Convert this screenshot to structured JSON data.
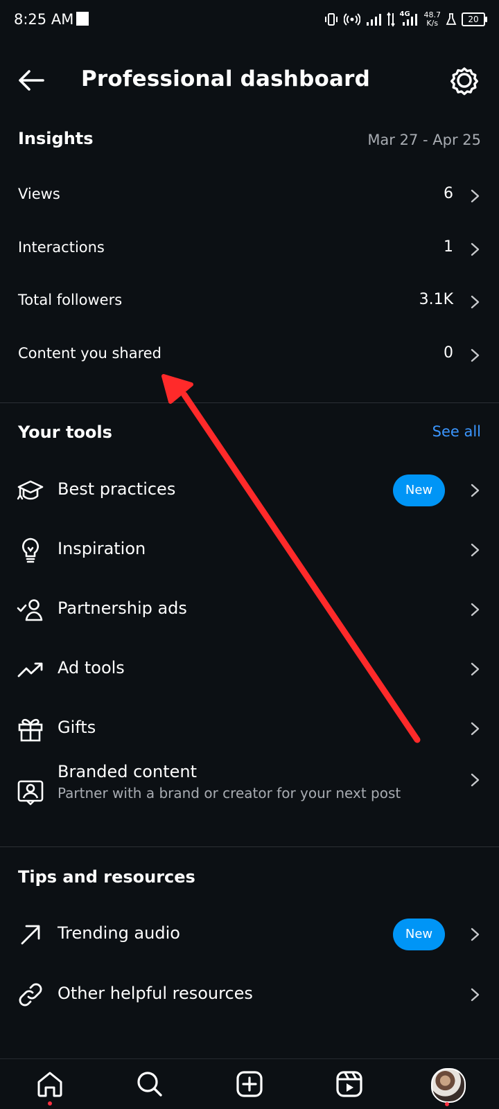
{
  "status_bar": {
    "time": "8:25 AM",
    "speed_value": "48.7",
    "speed_unit": "K/s",
    "network": "4G",
    "battery": "20"
  },
  "header": {
    "title": "Professional dashboard",
    "back_icon": "arrow-left-icon",
    "settings_icon": "gear-icon"
  },
  "insights": {
    "heading": "Insights",
    "date_range": "Mar 27 - Apr 25",
    "rows": [
      {
        "label": "Views",
        "value": "6"
      },
      {
        "label": "Interactions",
        "value": "1"
      },
      {
        "label": "Total followers",
        "value": "3.1K"
      },
      {
        "label": "Content you shared",
        "value": "0"
      }
    ]
  },
  "tools": {
    "heading": "Your tools",
    "see_all": "See all",
    "items": [
      {
        "label": "Best practices",
        "icon": "graduation-cap-icon",
        "badge": "New"
      },
      {
        "label": "Inspiration",
        "icon": "lightbulb-icon"
      },
      {
        "label": "Partnership ads",
        "icon": "person-check-icon"
      },
      {
        "label": "Ad tools",
        "icon": "trending-line-icon"
      },
      {
        "label": "Gifts",
        "icon": "gift-icon"
      },
      {
        "label": "Branded content",
        "sublabel": "Partner with a brand or creator for your next post",
        "icon": "branded-content-icon"
      }
    ]
  },
  "tips": {
    "heading": "Tips and resources",
    "items": [
      {
        "label": "Trending audio",
        "icon": "arrow-up-right-icon",
        "badge": "New"
      },
      {
        "label": "Other helpful resources",
        "icon": "link-icon"
      }
    ]
  },
  "bottom_nav": {
    "items": [
      "home-icon",
      "search-icon",
      "create-icon",
      "reels-icon",
      "profile-avatar"
    ]
  },
  "colors": {
    "background": "#0c1014",
    "accent": "#0095f6",
    "link": "#3b96ff",
    "annotation_arrow": "#ff2a2a"
  }
}
